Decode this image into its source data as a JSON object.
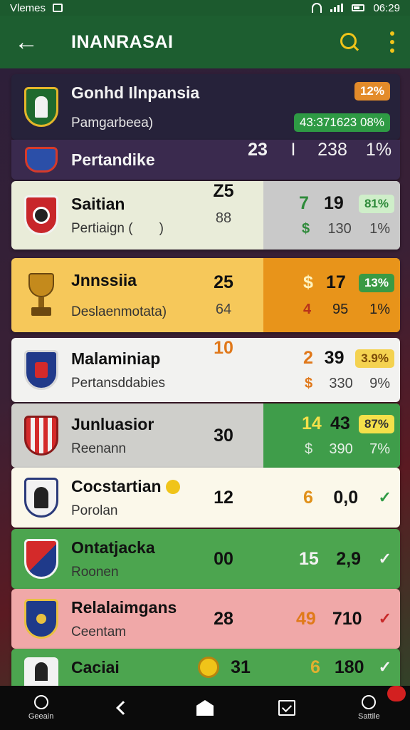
{
  "status_bar": {
    "carrier": "Vlemes",
    "time": "06:29"
  },
  "app_bar": {
    "back_label": "←",
    "title": "INANRASAI"
  },
  "rows": [
    {
      "name": "Gonhd Ilnpansia",
      "sub": "Pamgarbeea)",
      "pill": "12%",
      "pill2": "43:371623 08%"
    },
    {
      "name": "Pertandike",
      "n1": "23",
      "n2": "I",
      "n3": "238",
      "pct": "1%"
    },
    {
      "name": "Saitian",
      "sub": "Pertiaign (",
      "sub_tail": ")",
      "n1": "Z5",
      "n1b": "88",
      "a": "7",
      "ab": "$",
      "b": "19",
      "bb": "130",
      "pill": "81%",
      "pb": "1%"
    },
    {
      "name": "Jnnssiia",
      "sub": "Deslaenmotata)",
      "n1": "25",
      "n1b": "64",
      "a": "$",
      "ab": "4",
      "b": "17",
      "bb": "95",
      "pill": "13%",
      "pb": "1%"
    },
    {
      "name": "Malaminiap",
      "sub": "Pertansddabies",
      "n1": "10",
      "a": "2",
      "ab": "$",
      "b": "39",
      "bb": "330",
      "pill": "3.9%",
      "pb": "9%"
    },
    {
      "name": "Junluasior",
      "sub": "Reenann",
      "n1": "30",
      "a": "14",
      "ab": "$",
      "b": "43",
      "bb": "390",
      "pill": "87%",
      "pb": "7%"
    },
    {
      "name": "Cocstartian",
      "sub": "Porolan",
      "n1": "12",
      "a": "6",
      "b": "0,0"
    },
    {
      "name": "Ontatjacka",
      "sub": "Roonen",
      "n1": "00",
      "a": "15",
      "b": "2,9"
    },
    {
      "name": "Relalaimgans",
      "sub": "Ceentam",
      "n1": "28",
      "a": "49",
      "b": "710"
    },
    {
      "name": "Caciai",
      "n1": "31",
      "a": "6",
      "b": "180"
    }
  ],
  "bottom_nav": {
    "first_label": "Geeain",
    "last_label": "Sattile"
  },
  "colors": {
    "app_bar": "#1d5e30",
    "accent_yellow": "#f0c419",
    "orange": "#e8941a",
    "green": "#3f9d4a"
  }
}
